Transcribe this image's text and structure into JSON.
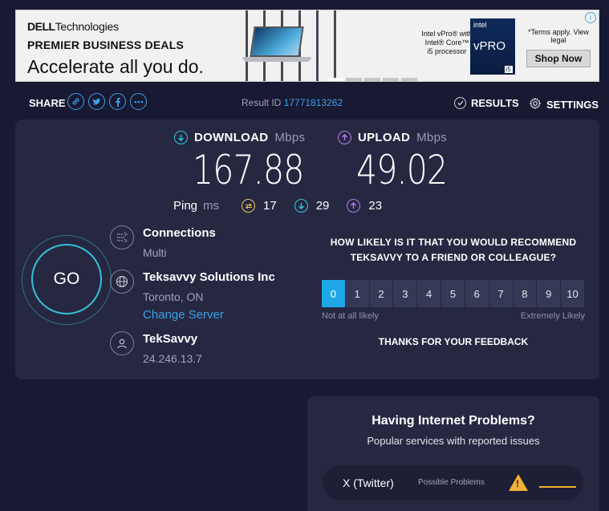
{
  "ad": {
    "brand_bold": "DELL",
    "brand_rest": "Technologies",
    "headline": "PREMIER BUSINESS DEALS",
    "tagline": "Accelerate all you do.",
    "vpro_text": "Intel vPro® with Intel® Core™ i5 processor",
    "badge_intel": "intel",
    "badge_vpro": "vPRO",
    "badge_i5": "i5",
    "terms": "*Terms apply. View legal",
    "shop_label": "Shop Now",
    "info_glyph": "i"
  },
  "topbar": {
    "share_label": "SHARE",
    "result_label": "Result ID",
    "result_id": "17771813262",
    "results_label": "RESULTS",
    "settings_label": "SETTINGS"
  },
  "download": {
    "label": "DOWNLOAD",
    "unit": "Mbps",
    "value": "167.88"
  },
  "upload": {
    "label": "UPLOAD",
    "unit": "Mbps",
    "value": "49.02"
  },
  "ping": {
    "label": "Ping",
    "unit": "ms",
    "idle": "17",
    "download": "29",
    "upload": "23"
  },
  "go_label": "GO",
  "connections": {
    "title": "Connections",
    "value": "Multi"
  },
  "server": {
    "title": "Teksavvy Solutions Inc",
    "location": "Toronto, ON",
    "change_label": "Change Server"
  },
  "isp": {
    "title": "TekSavvy",
    "ip": "24.246.13.7"
  },
  "survey": {
    "question": "HOW LIKELY IS IT THAT YOU WOULD RECOMMEND TEKSAVVY TO A FRIEND OR COLLEAGUE?",
    "scale": [
      "0",
      "1",
      "2",
      "3",
      "4",
      "5",
      "6",
      "7",
      "8",
      "9",
      "10"
    ],
    "selected": 0,
    "low_label": "Not at all likely",
    "high_label": "Extremely Likely",
    "thanks": "THANKS FOR YOUR FEEDBACK"
  },
  "problems": {
    "title": "Having Internet Problems?",
    "subtitle": "Popular services with reported issues",
    "items": [
      {
        "name": "X (Twitter)",
        "status": "Possible Problems"
      }
    ]
  },
  "colors": {
    "accent": "#3aa0e8",
    "download": "#30c7d6",
    "upload": "#b37fe8",
    "ping": "#e8c95a",
    "warning": "#f2b134",
    "selected_scale": "#1fa8e8"
  },
  "icons": [
    "link-icon",
    "twitter-icon",
    "facebook-icon",
    "more-icon",
    "check-circle-icon",
    "gear-icon",
    "download-arrow-icon",
    "upload-arrow-icon",
    "ping-icon",
    "connections-icon",
    "globe-icon",
    "user-icon",
    "warning-icon"
  ]
}
